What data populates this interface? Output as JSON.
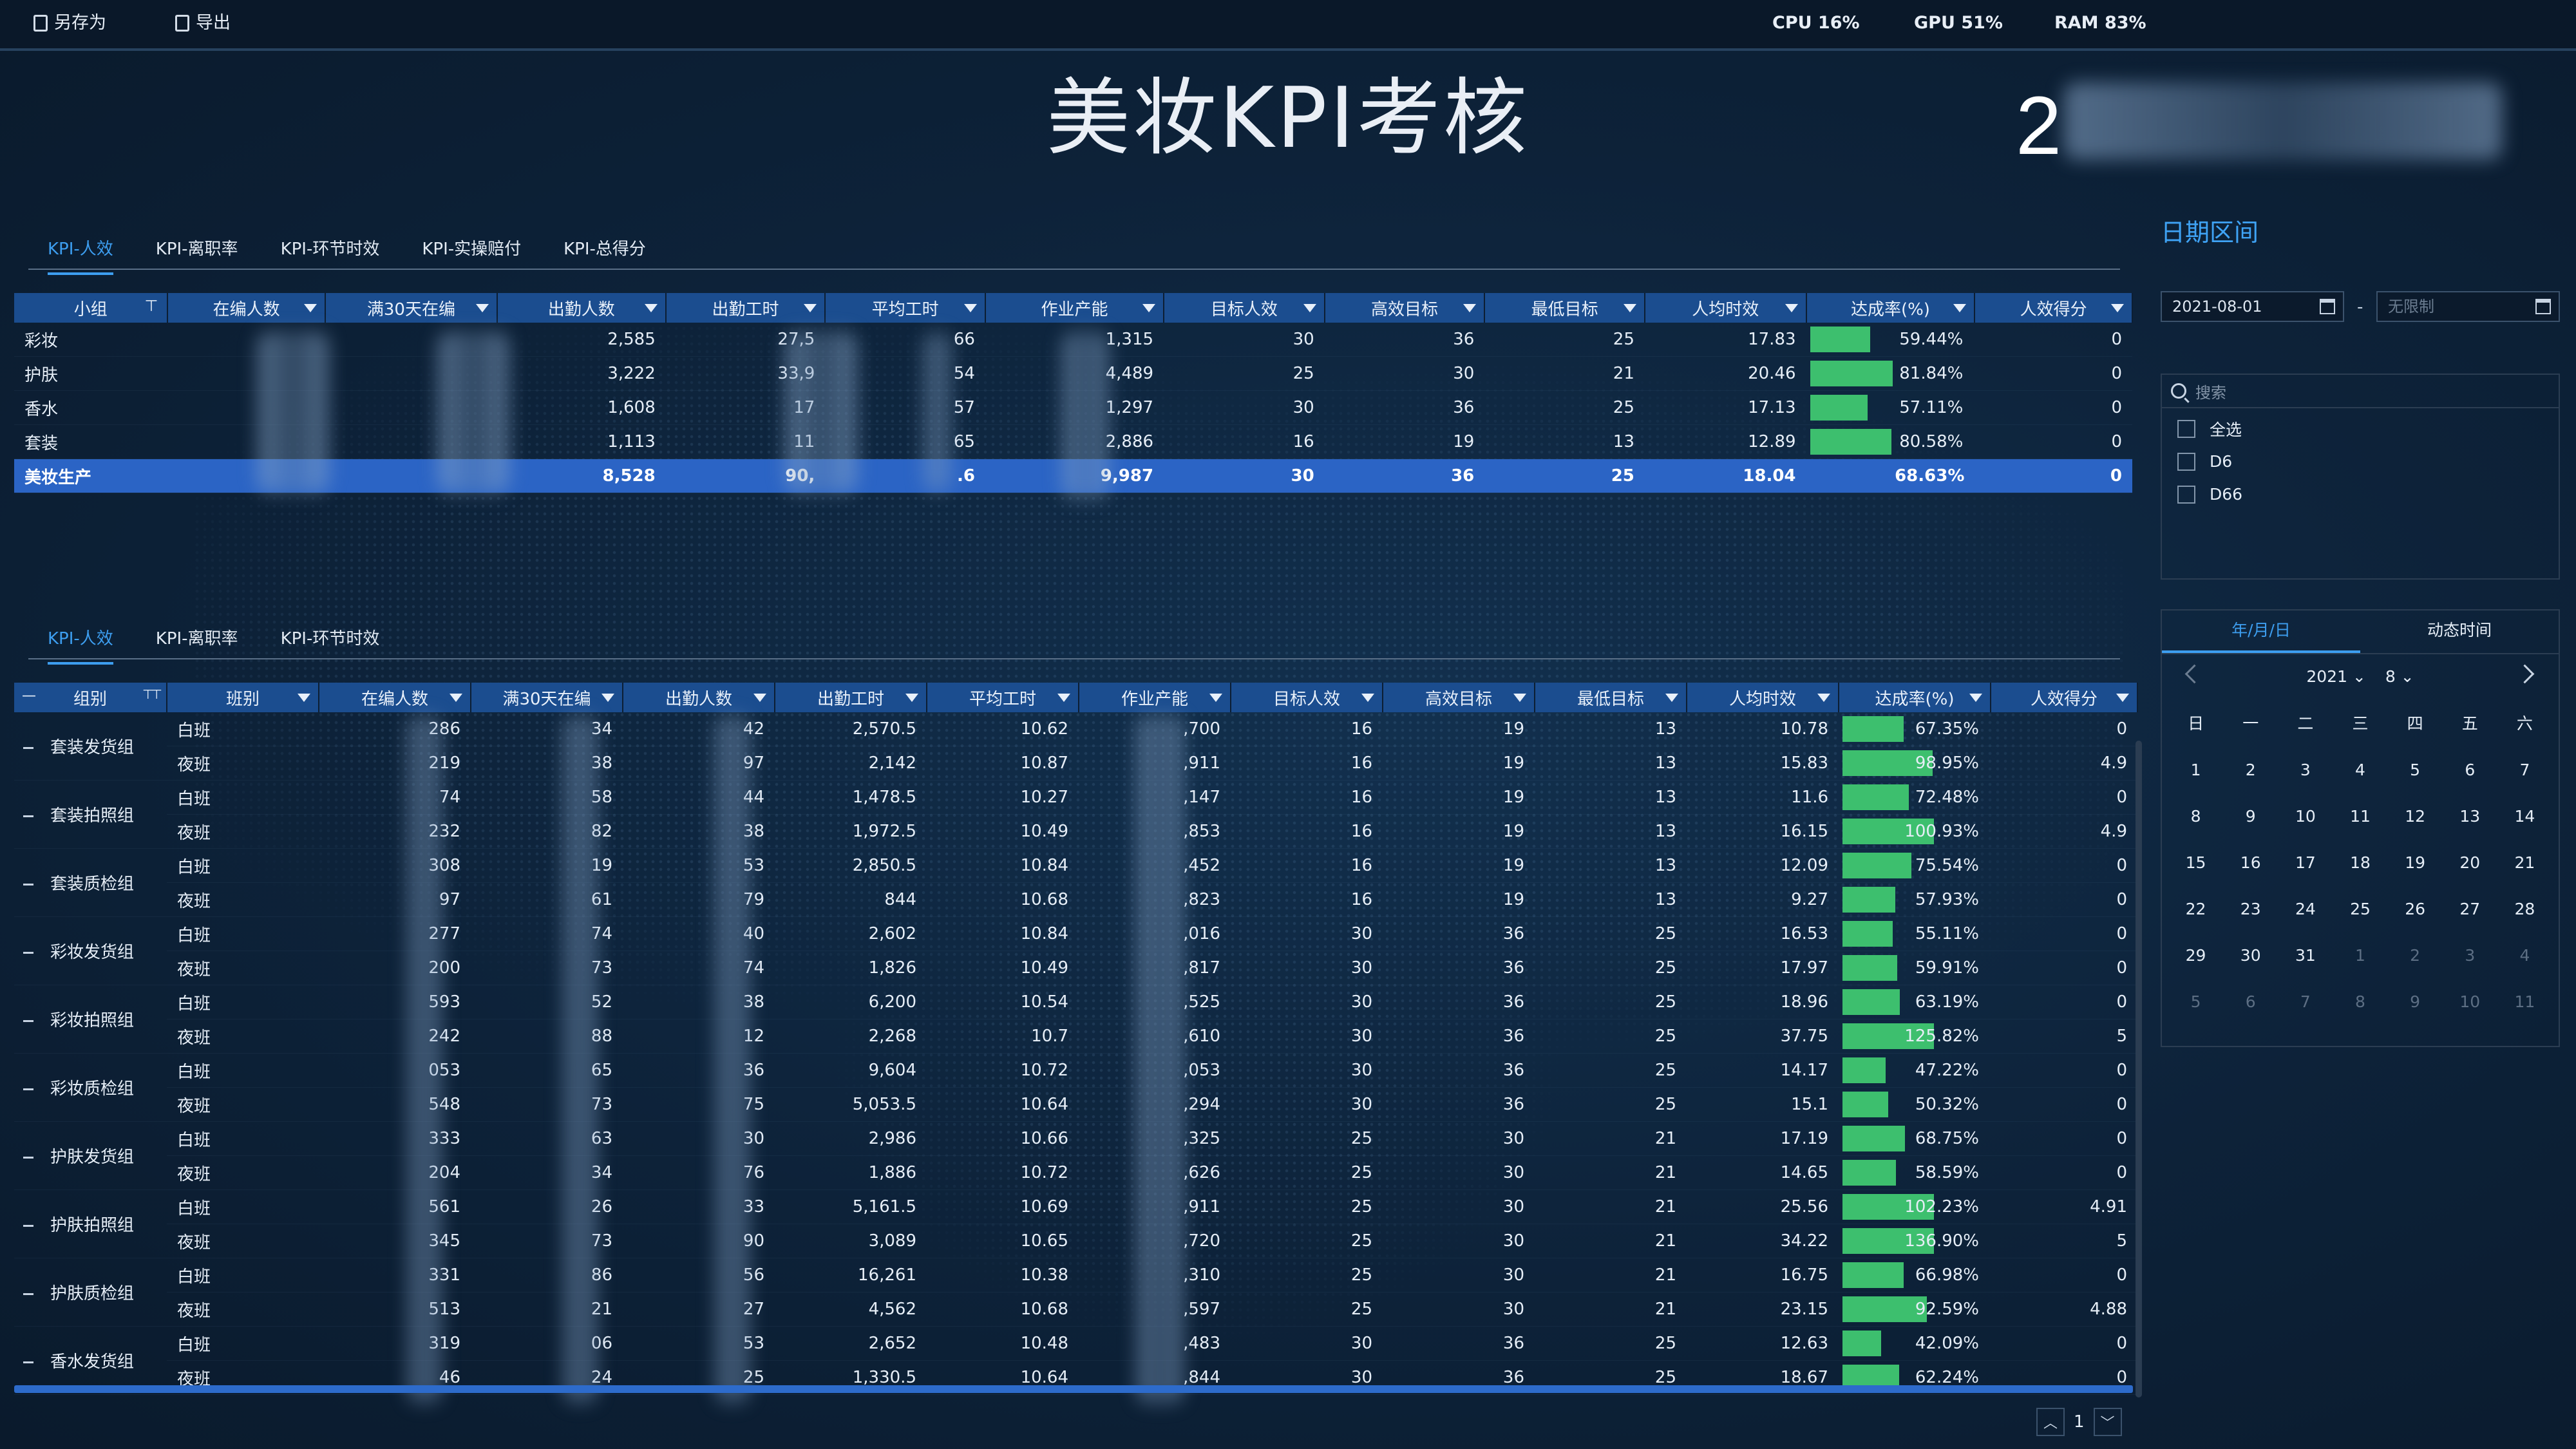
{
  "toolbar": {
    "save_as_label": "另存为",
    "export_label": "导出"
  },
  "system_stats": {
    "cpu": "CPU 16%",
    "gpu": "GPU 51%",
    "ram": "RAM 83%"
  },
  "page_title": "美妆KPI考核",
  "date_display_prefix": "2",
  "colors": {
    "header_bg": "#1b4d8f",
    "total_row_bg": "#2b64c5",
    "bar_green": "#3dbf6e",
    "accent_blue": "#3d9ef0"
  },
  "top_tabs": [
    "KPI-人效",
    "KPI-离职率",
    "KPI-环节时效",
    "KPI-实操赔付",
    "KPI-总得分"
  ],
  "top_table": {
    "headers": [
      "小组",
      "在编人数",
      "满30天在编",
      "出勤人数",
      "出勤工时",
      "平均工时",
      "作业产能",
      "目标人效",
      "高效目标",
      "最低目标",
      "人均时效",
      "达成率(%)",
      "人效得分"
    ],
    "rows": [
      {
        "cells": [
          "彩妆",
          "",
          "",
          "2,585",
          "27,5",
          "66",
          "1,315",
          "30",
          "36",
          "25",
          "17.83",
          "59.44%",
          "0"
        ],
        "rate": 59.44
      },
      {
        "cells": [
          "护肤",
          "",
          "",
          "3,222",
          "33,9",
          "54",
          "4,489",
          "25",
          "30",
          "21",
          "20.46",
          "81.84%",
          "0"
        ],
        "rate": 81.84
      },
      {
        "cells": [
          "香水",
          "",
          "",
          "1,608",
          "17",
          "57",
          "1,297",
          "30",
          "36",
          "25",
          "17.13",
          "57.11%",
          "0"
        ],
        "rate": 57.11
      },
      {
        "cells": [
          "套装",
          "",
          "",
          "1,113",
          "11",
          "65",
          "2,886",
          "16",
          "19",
          "13",
          "12.89",
          "80.58%",
          "0"
        ],
        "rate": 80.58
      }
    ],
    "total": {
      "cells": [
        "美妆生产",
        "",
        "",
        "8,528",
        "90,",
        ".6",
        "9,987",
        "30",
        "36",
        "25",
        "18.04",
        "68.63%",
        "0"
      ]
    }
  },
  "bottom_tabs": [
    "KPI-人效",
    "KPI-离职率",
    "KPI-环节时效"
  ],
  "bottom_table": {
    "headers": [
      "组别",
      "班别",
      "在编人数",
      "满30天在编",
      "出勤人数",
      "出勤工时",
      "平均工时",
      "作业产能",
      "目标人效",
      "高效目标",
      "最低目标",
      "人均时效",
      "达成率(%)",
      "人效得分"
    ],
    "groups": [
      {
        "name": "套装发货组",
        "rows": [
          {
            "cells": [
              "白班",
              "286",
              "34",
              "42",
              "2,570.5",
              "10.62",
              ",700",
              "16",
              "19",
              "13",
              "10.78",
              "67.35%",
              "0"
            ],
            "rate": 67.35
          },
          {
            "cells": [
              "夜班",
              "219",
              "38",
              "97",
              "2,142",
              "10.87",
              ",911",
              "16",
              "19",
              "13",
              "15.83",
              "98.95%",
              "4.9"
            ],
            "rate": 98.95
          }
        ]
      },
      {
        "name": "套装拍照组",
        "rows": [
          {
            "cells": [
              "白班",
              "74",
              "58",
              "44",
              "1,478.5",
              "10.27",
              ",147",
              "16",
              "19",
              "13",
              "11.6",
              "72.48%",
              "0"
            ],
            "rate": 72.48
          },
          {
            "cells": [
              "夜班",
              "232",
              "82",
              "38",
              "1,972.5",
              "10.49",
              ",853",
              "16",
              "19",
              "13",
              "16.15",
              "100.93%",
              "4.9"
            ],
            "rate": 100.93
          }
        ]
      },
      {
        "name": "套装质检组",
        "rows": [
          {
            "cells": [
              "白班",
              "308",
              "19",
              "53",
              "2,850.5",
              "10.84",
              ",452",
              "16",
              "19",
              "13",
              "12.09",
              "75.54%",
              "0"
            ],
            "rate": 75.54
          },
          {
            "cells": [
              "夜班",
              "97",
              "61",
              "79",
              "844",
              "10.68",
              ",823",
              "16",
              "19",
              "13",
              "9.27",
              "57.93%",
              "0"
            ],
            "rate": 57.93
          }
        ]
      },
      {
        "name": "彩妆发货组",
        "rows": [
          {
            "cells": [
              "白班",
              "277",
              "74",
              "40",
              "2,602",
              "10.84",
              ",016",
              "30",
              "36",
              "25",
              "16.53",
              "55.11%",
              "0"
            ],
            "rate": 55.11
          },
          {
            "cells": [
              "夜班",
              "200",
              "73",
              "74",
              "1,826",
              "10.49",
              ",817",
              "30",
              "36",
              "25",
              "17.97",
              "59.91%",
              "0"
            ],
            "rate": 59.91
          }
        ]
      },
      {
        "name": "彩妆拍照组",
        "rows": [
          {
            "cells": [
              "白班",
              "593",
              "52",
              "38",
              "6,200",
              "10.54",
              ",525",
              "30",
              "36",
              "25",
              "18.96",
              "63.19%",
              "0"
            ],
            "rate": 63.19
          },
          {
            "cells": [
              "夜班",
              "242",
              "88",
              "12",
              "2,268",
              "10.7",
              ",610",
              "30",
              "36",
              "25",
              "37.75",
              "125.82%",
              "5"
            ],
            "rate": 125.82
          }
        ]
      },
      {
        "name": "彩妆质检组",
        "rows": [
          {
            "cells": [
              "白班",
              "053",
              "65",
              "36",
              "9,604",
              "10.72",
              ",053",
              "30",
              "36",
              "25",
              "14.17",
              "47.22%",
              "0"
            ],
            "rate": 47.22
          },
          {
            "cells": [
              "夜班",
              "548",
              "73",
              "75",
              "5,053.5",
              "10.64",
              ",294",
              "30",
              "36",
              "25",
              "15.1",
              "50.32%",
              "0"
            ],
            "rate": 50.32
          }
        ]
      },
      {
        "name": "护肤发货组",
        "rows": [
          {
            "cells": [
              "白班",
              "333",
              "63",
              "30",
              "2,986",
              "10.66",
              ",325",
              "25",
              "30",
              "21",
              "17.19",
              "68.75%",
              "0"
            ],
            "rate": 68.75
          },
          {
            "cells": [
              "夜班",
              "204",
              "34",
              "76",
              "1,886",
              "10.72",
              ",626",
              "25",
              "30",
              "21",
              "14.65",
              "58.59%",
              "0"
            ],
            "rate": 58.59
          }
        ]
      },
      {
        "name": "护肤拍照组",
        "rows": [
          {
            "cells": [
              "白班",
              "561",
              "26",
              "33",
              "5,161.5",
              "10.69",
              ",911",
              "25",
              "30",
              "21",
              "25.56",
              "102.23%",
              "4.91"
            ],
            "rate": 102.23
          },
          {
            "cells": [
              "夜班",
              "345",
              "73",
              "90",
              "3,089",
              "10.65",
              ",720",
              "25",
              "30",
              "21",
              "34.22",
              "136.90%",
              "5"
            ],
            "rate": 136.9
          }
        ]
      },
      {
        "name": "护肤质检组",
        "rows": [
          {
            "cells": [
              "白班",
              "331",
              "86",
              "56",
              "16,261",
              "10.38",
              ",310",
              "25",
              "30",
              "21",
              "16.75",
              "66.98%",
              "0"
            ],
            "rate": 66.98
          },
          {
            "cells": [
              "夜班",
              "513",
              "21",
              "27",
              "4,562",
              "10.68",
              ",597",
              "25",
              "30",
              "21",
              "23.15",
              "92.59%",
              "4.88"
            ],
            "rate": 92.59
          }
        ]
      },
      {
        "name": "香水发货组",
        "rows": [
          {
            "cells": [
              "白班",
              "319",
              "06",
              "53",
              "2,652",
              "10.48",
              ",483",
              "30",
              "36",
              "25",
              "12.63",
              "42.09%",
              "0"
            ],
            "rate": 42.09
          },
          {
            "cells": [
              "夜班",
              "46",
              "24",
              "25",
              "1,330.5",
              "10.64",
              ",844",
              "30",
              "36",
              "25",
              "18.67",
              "62.24%",
              "0"
            ],
            "rate": 62.24
          }
        ]
      }
    ]
  },
  "pager": {
    "page": "1"
  },
  "right_panel": {
    "title": "日期区间",
    "date_start": "2021-08-01",
    "date_end_placeholder": "无限制",
    "dash": "-",
    "search_placeholder": "搜索",
    "options": [
      "全选",
      "D6",
      "D66"
    ],
    "calendar": {
      "tabs": [
        "年/月/日",
        "动态时间"
      ],
      "year": "2021",
      "month": "8",
      "weekdays": [
        "日",
        "一",
        "二",
        "三",
        "四",
        "五",
        "六"
      ],
      "days": [
        {
          "d": "1",
          "o": false
        },
        {
          "d": "2",
          "o": false
        },
        {
          "d": "3",
          "o": false
        },
        {
          "d": "4",
          "o": false
        },
        {
          "d": "5",
          "o": false
        },
        {
          "d": "6",
          "o": false
        },
        {
          "d": "7",
          "o": false
        },
        {
          "d": "8",
          "o": false
        },
        {
          "d": "9",
          "o": false
        },
        {
          "d": "10",
          "o": false
        },
        {
          "d": "11",
          "o": false
        },
        {
          "d": "12",
          "o": false
        },
        {
          "d": "13",
          "o": false
        },
        {
          "d": "14",
          "o": false
        },
        {
          "d": "15",
          "o": false
        },
        {
          "d": "16",
          "o": false
        },
        {
          "d": "17",
          "o": false
        },
        {
          "d": "18",
          "o": false
        },
        {
          "d": "19",
          "o": false
        },
        {
          "d": "20",
          "o": false
        },
        {
          "d": "21",
          "o": false
        },
        {
          "d": "22",
          "o": false
        },
        {
          "d": "23",
          "o": false
        },
        {
          "d": "24",
          "o": false
        },
        {
          "d": "25",
          "o": false
        },
        {
          "d": "26",
          "o": false
        },
        {
          "d": "27",
          "o": false
        },
        {
          "d": "28",
          "o": false
        },
        {
          "d": "29",
          "o": false
        },
        {
          "d": "30",
          "o": false
        },
        {
          "d": "31",
          "o": false
        },
        {
          "d": "1",
          "o": true
        },
        {
          "d": "2",
          "o": true
        },
        {
          "d": "3",
          "o": true
        },
        {
          "d": "4",
          "o": true
        },
        {
          "d": "5",
          "o": true
        },
        {
          "d": "6",
          "o": true
        },
        {
          "d": "7",
          "o": true
        },
        {
          "d": "8",
          "o": true
        },
        {
          "d": "9",
          "o": true
        },
        {
          "d": "10",
          "o": true
        },
        {
          "d": "11",
          "o": true
        }
      ]
    }
  }
}
